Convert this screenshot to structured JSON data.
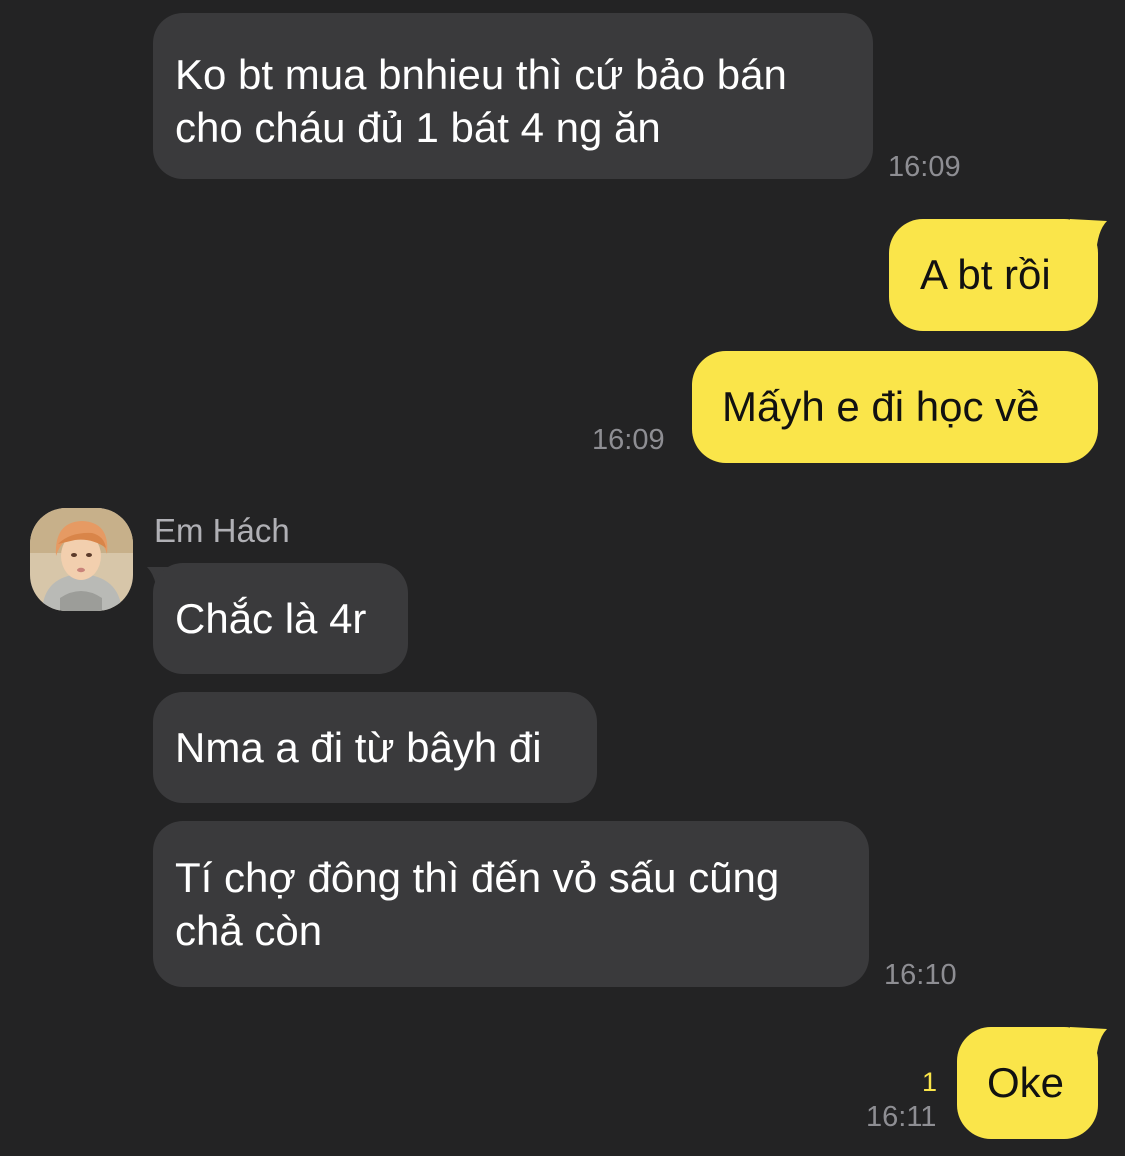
{
  "chat": {
    "messages": [
      {
        "sender": "other",
        "text": "Ko bt mua bnhieu thì cứ bảo bán\ncho cháu đủ 1 bát 4 ng ăn",
        "time": "16:09"
      },
      {
        "sender": "me",
        "text": "A bt rồi"
      },
      {
        "sender": "me",
        "text": "Mấyh e đi học về",
        "time": "16:09"
      },
      {
        "sender": "other",
        "name": "Em Hách",
        "avatar_icon": "profile-photo",
        "text": "Chắc là 4r"
      },
      {
        "sender": "other",
        "text": "Nma a đi từ bâyh đi"
      },
      {
        "sender": "other",
        "text": "Tí chợ đông thì đến vỏ sấu cũng\nchả còn",
        "time": "16:10"
      },
      {
        "sender": "me",
        "text": "Oke",
        "time": "16:11",
        "unread_count": "1"
      }
    ]
  },
  "colors": {
    "background": "#232324",
    "incoming_bubble": "#3a3a3c",
    "outgoing_bubble": "#fae54a",
    "timestamp": "#8e8e93",
    "unread_badge": "#fae54a"
  }
}
